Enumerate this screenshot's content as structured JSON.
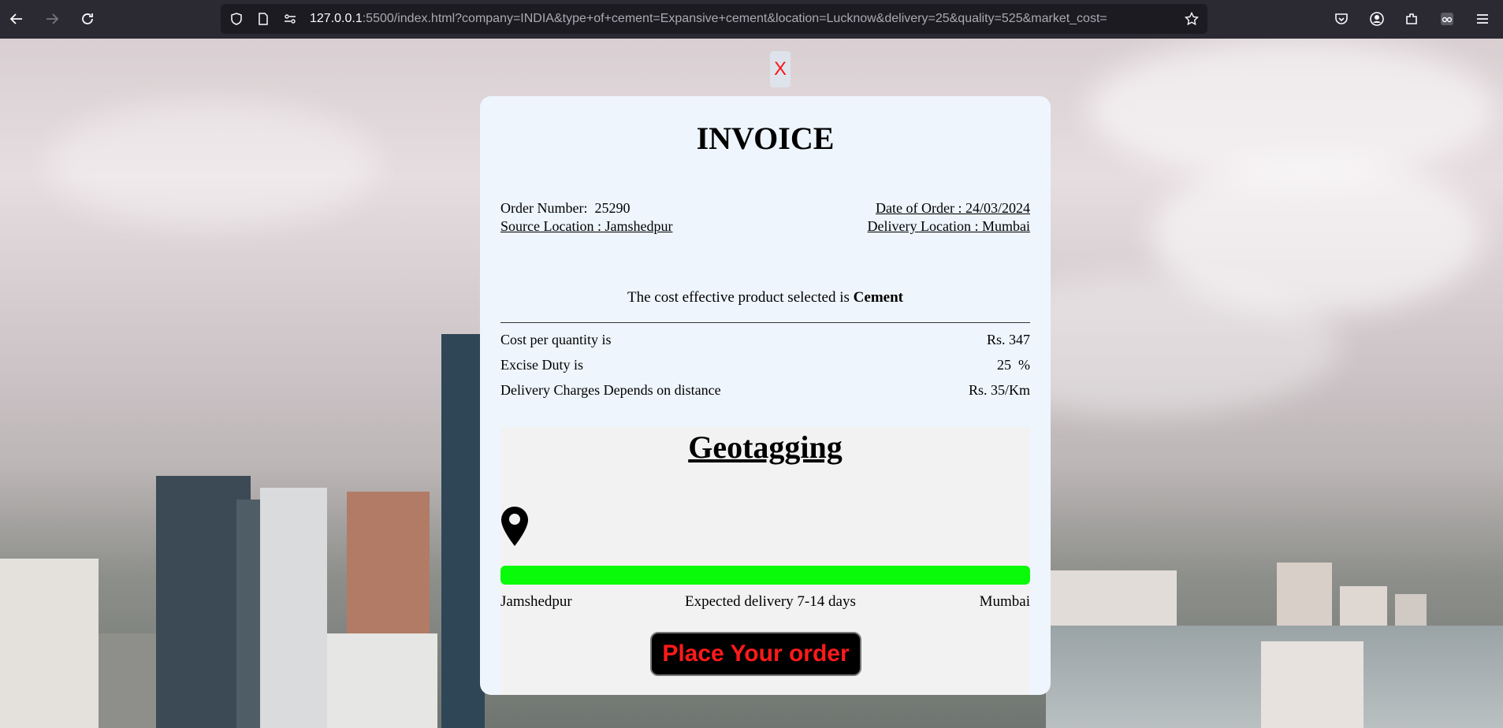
{
  "browser": {
    "url_host": "127.0.0.1",
    "url_rest": ":5500/index.html?company=INDIA&type+of+cement=Expansive+cement&location=Lucknow&delivery=25&quality=525&market_cost="
  },
  "popup": {
    "close_label": "X"
  },
  "invoice": {
    "title": "INVOICE",
    "order_number_label": "Order Number:",
    "order_number": "25290",
    "date_of_order": "Date of Order : 24/03/2024",
    "source_location": "Source Location : Jamshedpur",
    "delivery_location": "Delivery Location : Mumbai",
    "product_prefix": "The cost effective product selected is",
    "product_name": "Cement",
    "rows": [
      {
        "label": "Cost per quantity is",
        "value": "Rs. 347"
      },
      {
        "label": "Excise Duty is",
        "value": "25  %"
      },
      {
        "label": "Delivery Charges Depends on distance",
        "value": "Rs. 35/Km"
      }
    ]
  },
  "geotagging": {
    "title": "Geotagging",
    "progress_fraction": 1.0,
    "source": "Jamshedpur",
    "expected": "Expected delivery 7-14 days",
    "destination": "Mumbai",
    "button_label": "Place Your order"
  },
  "colors": {
    "progress": "#09fb09",
    "button_text": "#ff1a1a",
    "close": "#ff0000"
  }
}
